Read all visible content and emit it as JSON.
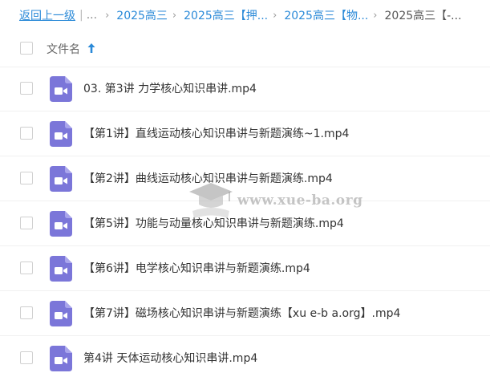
{
  "breadcrumb": {
    "back_label": "返回上一级",
    "ellipsis": "...",
    "separator": "|",
    "arrow": "›",
    "items": [
      "2025高三",
      "2025高三【押...",
      "2025高三【物...",
      "2025高三【-..."
    ]
  },
  "table": {
    "header_label": "文件名",
    "sort": "ascending",
    "accent_color": "#2b8ad8",
    "file_icon_color": "#7b76d9",
    "rows": [
      {
        "name": "03. 第3讲 力学核心知识串讲.mp4",
        "icon": "video-file-icon"
      },
      {
        "name": "【第1讲】直线运动核心知识串讲与新题演练~1.mp4",
        "icon": "video-file-icon"
      },
      {
        "name": "【第2讲】曲线运动核心知识串讲与新题演练.mp4",
        "icon": "video-file-icon"
      },
      {
        "name": "【第5讲】功能与动量核心知识串讲与新题演练.mp4",
        "icon": "video-file-icon"
      },
      {
        "name": "【第6讲】电学核心知识串讲与新题演练.mp4",
        "icon": "video-file-icon"
      },
      {
        "name": "【第7讲】磁场核心知识串讲与新题演练【xu e-b a.org】.mp4",
        "icon": "video-file-icon"
      },
      {
        "name": "第4讲 天体运动核心知识串讲.mp4",
        "icon": "video-file-icon"
      }
    ]
  },
  "watermark": {
    "text": "www.xue-ba.org"
  }
}
